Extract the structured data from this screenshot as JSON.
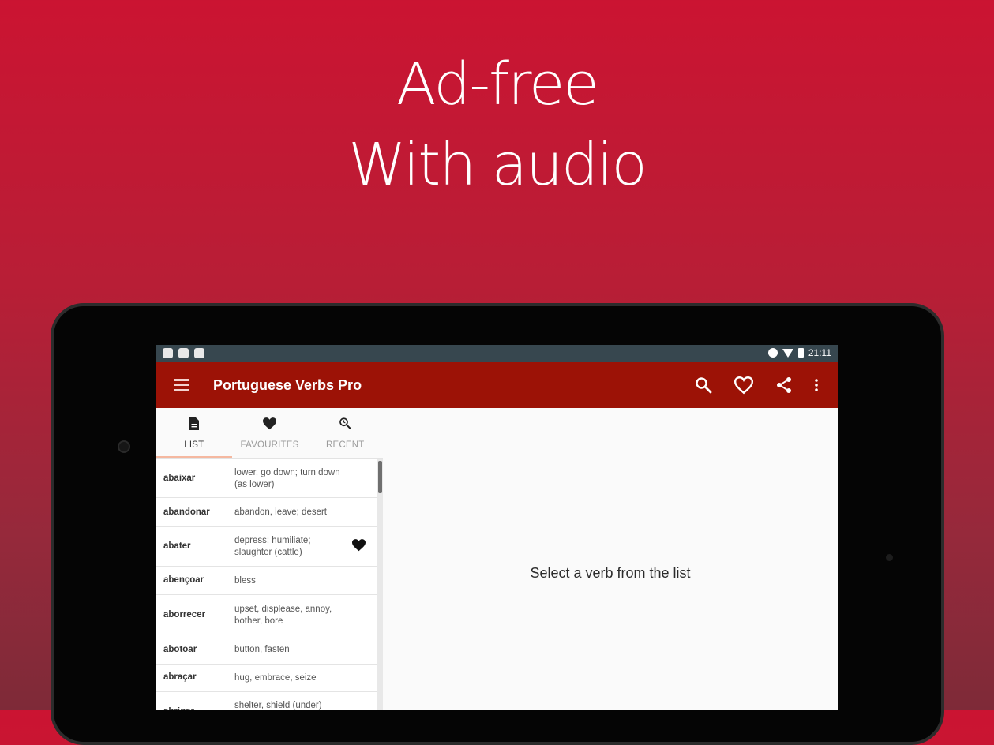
{
  "promo": {
    "line1": "Ad-free",
    "line2": "With audio"
  },
  "status_bar": {
    "time": "21:11"
  },
  "app_bar": {
    "title": "Portuguese Verbs Pro",
    "actions": [
      "search-icon",
      "heart-outline-icon",
      "share-icon",
      "more-vert-icon"
    ]
  },
  "tabs": [
    {
      "label": "LIST",
      "icon": "document-icon",
      "active": true
    },
    {
      "label": "FAVOURITES",
      "icon": "heart-icon",
      "active": false
    },
    {
      "label": "RECENT",
      "icon": "search-history-icon",
      "active": false
    }
  ],
  "verbs": [
    {
      "verb": "abaixar",
      "translation": "lower, go down; turn down (as lower)",
      "favourite": false
    },
    {
      "verb": "abandonar",
      "translation": "abandon, leave; desert",
      "favourite": false
    },
    {
      "verb": "abater",
      "translation": "depress; humiliate; slaughter (cattle)",
      "favourite": true
    },
    {
      "verb": "abençoar",
      "translation": "bless",
      "favourite": false
    },
    {
      "verb": "aborrecer",
      "translation": "upset, displease, annoy, bother, bore",
      "favourite": false
    },
    {
      "verb": "abotoar",
      "translation": "button, fasten",
      "favourite": false
    },
    {
      "verb": "abraçar",
      "translation": "hug, embrace, seize",
      "favourite": false
    },
    {
      "verb": "abrigar",
      "translation": "shelter, shield (under)",
      "favourite": false
    }
  ],
  "detail": {
    "empty_message": "Select a verb from the list"
  },
  "colors": {
    "app_bar": "#9c1206",
    "status_bar": "#37474f",
    "tab_indicator": "#f5b8a0",
    "background_top": "#cb1432",
    "background_bottom": "#7e2a38"
  }
}
